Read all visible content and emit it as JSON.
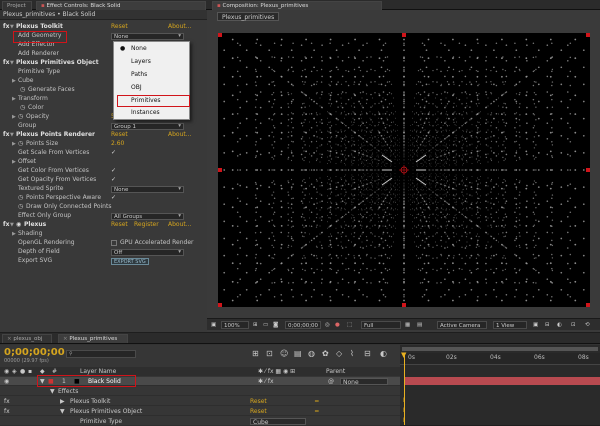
{
  "tabs": {
    "project": "Project",
    "effect_controls": "Effect Controls: Black Solid",
    "composition": "Composition: Plexus_primitives"
  },
  "effect_controls": {
    "header": "Plexus_primitives • Black Solid",
    "rows": {
      "toolkit": {
        "label": "Plexus Toolkit",
        "reset": "Reset",
        "about": "About..."
      },
      "add_geometry": {
        "label": "Add Geometry",
        "value": "None"
      },
      "add_effector": {
        "label": "Add Effector"
      },
      "add_renderer": {
        "label": "Add Renderer"
      },
      "primitives_object": {
        "label": "Plexus Primitives Object"
      },
      "primitive_type": {
        "label": "Primitive Type"
      },
      "cube": {
        "label": "Cube"
      },
      "generate_faces": {
        "label": "Generate Faces"
      },
      "transform": {
        "label": "Transform"
      },
      "color": {
        "label": "Color"
      },
      "opacity": {
        "label": "Opacity",
        "value": "50.0%"
      },
      "group": {
        "label": "Group",
        "value": "Group 1"
      },
      "points_renderer": {
        "label": "Plexus Points Renderer",
        "reset": "Reset",
        "about": "About..."
      },
      "points_size": {
        "label": "Points Size",
        "value": "2.60"
      },
      "scale_from_vertices": {
        "label": "Get Scale From Vertices"
      },
      "offset": {
        "label": "Offset"
      },
      "color_from_vertices": {
        "label": "Get Color From Vertices"
      },
      "opacity_from_vertices": {
        "label": "Get Opacity From Vertices"
      },
      "textured_sprite": {
        "label": "Textured Sprite",
        "value": "None"
      },
      "perspective_aware": {
        "label": "Points Perspective Aware"
      },
      "draw_connected": {
        "label": "Draw Only Connected Points"
      },
      "effect_only_group": {
        "label": "Effect Only Group",
        "value": "All Groups"
      },
      "plexus": {
        "label": "Plexus",
        "reset": "Reset",
        "register": "Register",
        "about": "About..."
      },
      "shading": {
        "label": "Shading"
      },
      "opengl": {
        "label": "OpenGL Rendering",
        "value": "GPU Accelerated Render"
      },
      "depth_of_field": {
        "label": "Depth of Field",
        "value": "Off"
      },
      "export_svg": {
        "label": "Export SVG",
        "value": "EXPORT SVG"
      }
    },
    "menu": [
      "None",
      "Layers",
      "Paths",
      "OBJ",
      "Primitives",
      "Instances"
    ]
  },
  "composition": {
    "tab_label": "Plexus_primitives",
    "zoom": "100%",
    "timecode": "0;00;00;00",
    "resolution": "Full",
    "camera": "Active Camera",
    "view": "1 View"
  },
  "timeline": {
    "tabs": [
      "plexus_obj",
      "Plexus_primitives"
    ],
    "timecode": "0;00;00;00",
    "frames": "00000 (29.97 fps)",
    "column_layer_name": "Layer Name",
    "column_parent": "Parent",
    "layer": {
      "number": "1",
      "name": "Black Solid",
      "parent": "None"
    },
    "effects_label": "Effects",
    "toolkit_label": "Plexus Toolkit",
    "toolkit_reset": "Reset",
    "primitives_label": "Plexus Primitives Object",
    "primitives_reset": "Reset",
    "primitive_type_label": "Primitive Type",
    "primitive_type_value": "Cube",
    "ruler": [
      "0s",
      "02s",
      "04s",
      "06s",
      "08s"
    ]
  }
}
